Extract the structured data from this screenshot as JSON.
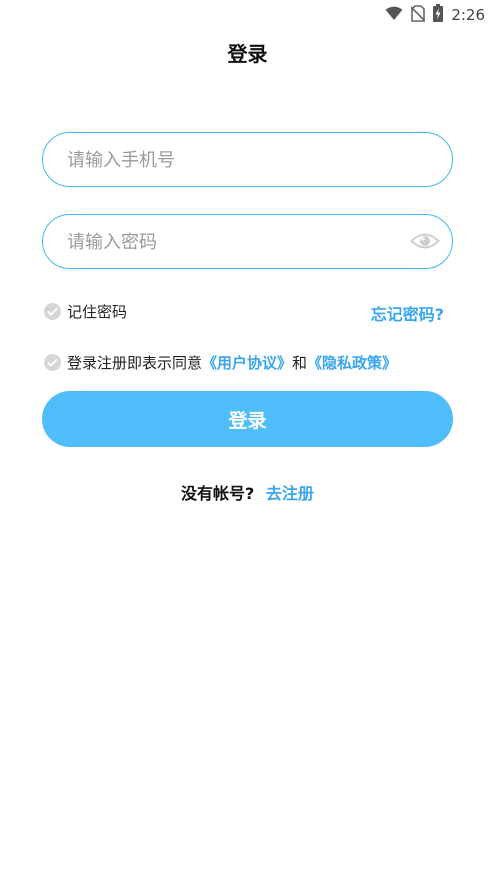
{
  "status_bar": {
    "time": "2:26",
    "icons": [
      "wifi-icon",
      "no-sim-icon",
      "battery-charging-icon"
    ]
  },
  "header": {
    "title": "登录"
  },
  "form": {
    "phone_placeholder": "请输入手机号",
    "phone_value": "",
    "password_placeholder": "请输入密码",
    "password_value": "",
    "password_toggle_icon": "eye-icon"
  },
  "options": {
    "remember_label": "记住密码",
    "forgot_label": "忘记密码?"
  },
  "agreement": {
    "prefix": "登录注册即表示同意",
    "user_agreement": "《用户协议》",
    "conjunction": "和",
    "privacy_policy": "《隐私政策》"
  },
  "login_button": {
    "label": "登录"
  },
  "register": {
    "prompt": "没有帐号?",
    "link": "去注册"
  },
  "colors": {
    "accent": "#4fbdf9",
    "link": "#3aa6ee",
    "border": "#45b8f2",
    "check": "#d6d6d6"
  }
}
